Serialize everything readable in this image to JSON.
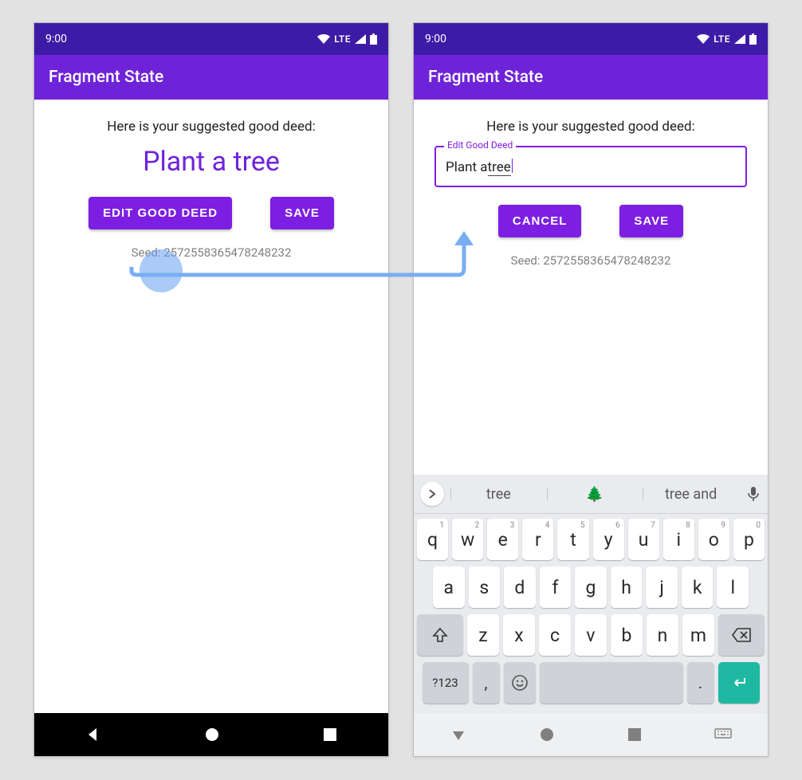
{
  "status": {
    "time": "9:00",
    "net_label": "LTE"
  },
  "appbar": {
    "title": "Fragment State"
  },
  "left": {
    "suggest": "Here is your suggested good deed:",
    "deed": "Plant a tree",
    "buttons": {
      "edit": "EDIT GOOD DEED",
      "save": "SAVE"
    },
    "seed": "Seed: 2572558365478248232"
  },
  "right": {
    "suggest": "Here is your suggested good deed:",
    "field_label": "Edit Good Deed",
    "field_value_prefix": "Plant a ",
    "field_value_underlined": "tree",
    "buttons": {
      "cancel": "CANCEL",
      "save": "SAVE"
    },
    "seed": "Seed: 2572558365478248232"
  },
  "keyboard": {
    "suggestions": [
      "tree",
      "🌲",
      "tree and"
    ],
    "row1": [
      [
        "q",
        "1"
      ],
      [
        "w",
        "2"
      ],
      [
        "e",
        "3"
      ],
      [
        "r",
        "4"
      ],
      [
        "t",
        "5"
      ],
      [
        "y",
        "6"
      ],
      [
        "u",
        "7"
      ],
      [
        "i",
        "8"
      ],
      [
        "o",
        "9"
      ],
      [
        "p",
        "0"
      ]
    ],
    "row2": [
      "a",
      "s",
      "d",
      "f",
      "g",
      "h",
      "j",
      "k",
      "l"
    ],
    "row3": [
      "z",
      "x",
      "c",
      "v",
      "b",
      "n",
      "m"
    ],
    "sym_key": "?123",
    "comma": ",",
    "period": "."
  }
}
